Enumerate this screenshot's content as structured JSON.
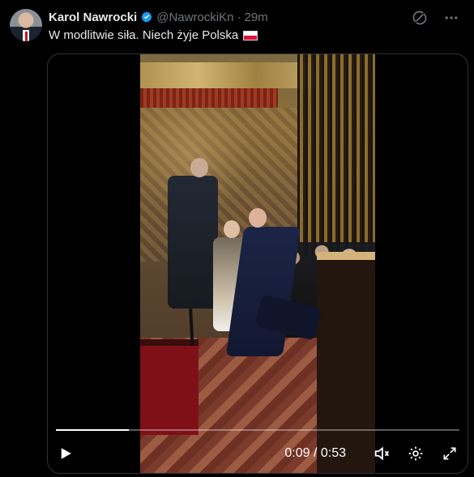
{
  "author": {
    "name": "Karol Nawrocki",
    "handle": "@NawrockiKn",
    "separator": "·",
    "time": "29m",
    "avatar_icon": "profile-avatar"
  },
  "tweet": {
    "text": "W modlitwie siła. Niech żyje Polska",
    "flag": "poland-flag-icon"
  },
  "video": {
    "current_time": "0:09",
    "separator": " / ",
    "duration": "0:53",
    "progress_percent": 18
  },
  "icons": {
    "verified": "verified-badge-icon",
    "grok": "grok-icon",
    "more": "more-icon",
    "play": "play-icon",
    "mute": "volume-muted-icon",
    "settings": "settings-gear-icon",
    "fullscreen": "fullscreen-icon"
  },
  "colors": {
    "background": "#000000",
    "text_primary": "#e7e9ea",
    "text_secondary": "#71767b",
    "verified_blue": "#1d9bf0"
  }
}
